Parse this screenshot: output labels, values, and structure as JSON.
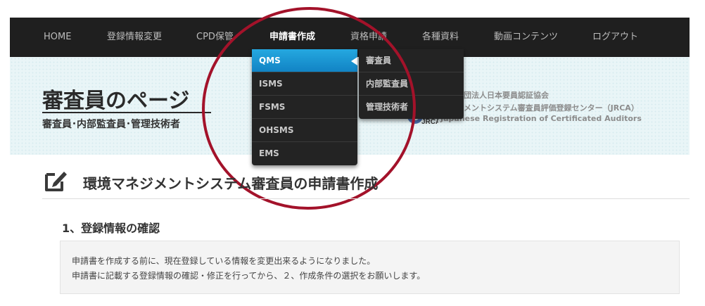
{
  "nav": {
    "items": [
      {
        "label": "HOME"
      },
      {
        "label": "登録情報変更"
      },
      {
        "label": "CPD保管"
      },
      {
        "label": "申請書作成"
      },
      {
        "label": "資格申請"
      },
      {
        "label": "各種資料"
      },
      {
        "label": "動画コンテンツ"
      },
      {
        "label": "ログアウト"
      }
    ],
    "active": "申請書作成"
  },
  "dropdown": {
    "items": [
      {
        "label": "QMS"
      },
      {
        "label": "ISMS"
      },
      {
        "label": "FSMS"
      },
      {
        "label": "OHSMS"
      },
      {
        "label": "EMS"
      }
    ],
    "selected": "QMS",
    "submenu": [
      {
        "label": "審査員"
      },
      {
        "label": "内部監査員"
      },
      {
        "label": "管理技術者"
      }
    ]
  },
  "hero": {
    "title": "審査員のページ",
    "subtitle": "審査員･内部監査員･管理技術者"
  },
  "org": {
    "logo_text": "JRCA",
    "line1": "一般財団法人日本要員認証協会",
    "line2": "マネジメントシステム審査員評価登録センター（JRCA）",
    "line3": "Japanese Registration of Certificated Auditors"
  },
  "content": {
    "heading": "環境マネジメントシステム審査員の申請書作成",
    "section_title": "1、登録情報の確認",
    "info_lines": [
      "申請書を作成する前に、現在登録している情報を変更出来るようになりました。",
      "申請書に記載する登録情報の確認・修正を行ってから、２、作成条件の選択をお願いします。"
    ]
  },
  "colors": {
    "nav_bg": "#1f1f1f",
    "selected_blue": "#1a9ad6",
    "annotation_red": "#a3122a",
    "hero_bg": "#e9f5f7"
  },
  "icons": {
    "edit": "edit-icon",
    "org_logo": "jrca-logo"
  }
}
